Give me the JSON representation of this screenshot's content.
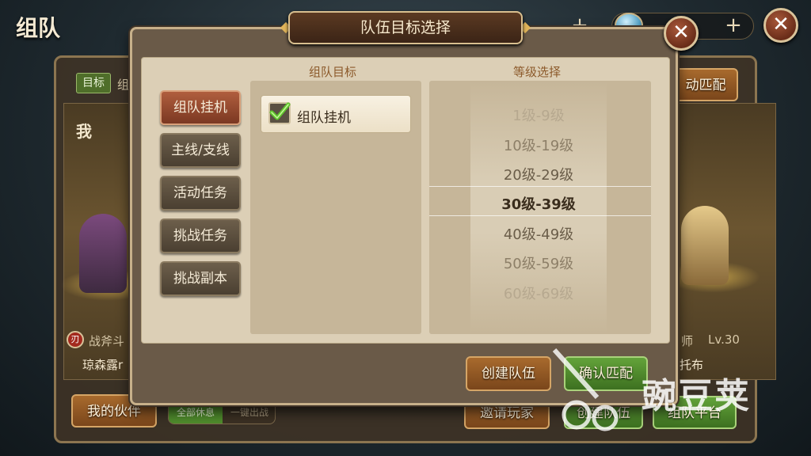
{
  "page_title": "组队",
  "modal": {
    "title": "队伍目标选择",
    "goal_column_title": "组队目标",
    "level_column_title": "等级选择",
    "categories": [
      {
        "label": "组队挂机",
        "active": true
      },
      {
        "label": "主线/支线",
        "active": false
      },
      {
        "label": "活动任务",
        "active": false
      },
      {
        "label": "挑战任务",
        "active": false
      },
      {
        "label": "挑战副本",
        "active": false
      }
    ],
    "goals": [
      {
        "label": "组队挂机",
        "checked": true
      }
    ],
    "levels": [
      "1级-9级",
      "10级-19级",
      "20级-29级",
      "30级-39级",
      "40级-49级",
      "50级-59级",
      "60级-69级"
    ],
    "selected_level": "30级-39级",
    "create_team_label": "创建队伍",
    "confirm_match_label": "确认匹配",
    "close_symbol": "✕"
  },
  "background": {
    "close_symbol": "✕",
    "plus_symbol": "+",
    "goal_tag": "目标",
    "goal_text_partial": "组",
    "auto_match_partial": "动匹配",
    "me_label": "我",
    "left_class": "战斧斗",
    "left_name": "琼森露r",
    "right_class_partial": "师",
    "right_level": "Lv.30",
    "right_name_partial": "托布",
    "my_partner_label": "我的伙伴",
    "toggle_all_rest": "全部休息",
    "toggle_one_click": "一键出战",
    "invite_players_label": "邀请玩家",
    "create_team_partial": "创建队伍",
    "team_platform_label": "组队平台",
    "class_icon_glyph": "刃"
  },
  "watermark": {
    "text": "豌豆荚"
  },
  "colors": {
    "active_tab": "#b05e3e",
    "button_brown": "#a86a2d",
    "button_green": "#63a33a",
    "selected_level_text": "#3a2d1d",
    "modal_border": "#c7b08a"
  }
}
